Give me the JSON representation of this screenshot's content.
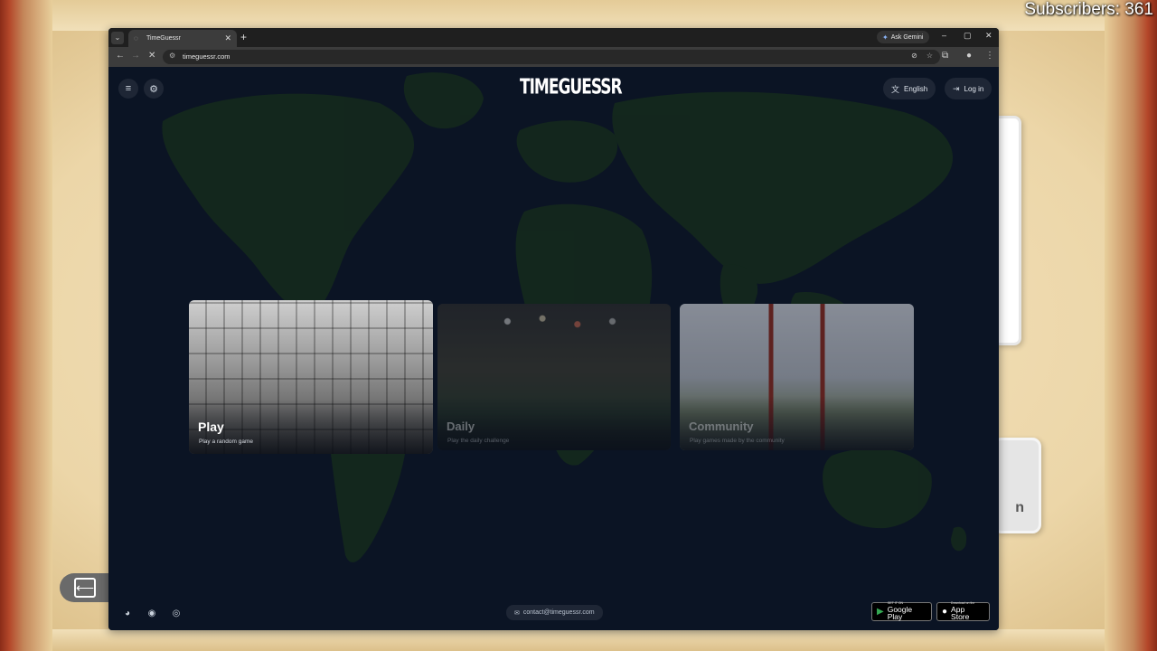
{
  "overlay": {
    "subscribers": "Subscribers: 361"
  },
  "browser": {
    "tab_title": "TimeGuessr",
    "new_tab": "+",
    "ask_gemini": "Ask Gemini",
    "url": "timeguessr.com",
    "window_controls": [
      "–",
      "▢",
      "✕"
    ]
  },
  "page": {
    "logo_text": "TIMEGUESSR",
    "language_label": "English",
    "login_label": "Log in",
    "modes": [
      {
        "title": "Play",
        "subtitle": "Play a random game"
      },
      {
        "title": "Daily",
        "subtitle": "Play the daily challenge"
      },
      {
        "title": "Community",
        "subtitle": "Play games made by the community"
      }
    ],
    "contact_email": "contact@timeguessr.com",
    "google_play": {
      "small": "GET IT ON",
      "big": "Google Play"
    },
    "app_store": {
      "small": "Download on the",
      "big": "App Store"
    }
  },
  "colors": {
    "page_bg": "#0b1424",
    "map_land": "#17331f",
    "text_primary": "#ffffff"
  },
  "icons": {
    "menu": "menu-icon",
    "settings": "gear-icon",
    "translate": "translate-icon",
    "login": "login-icon",
    "discord": "discord-icon",
    "reddit": "reddit-icon",
    "instagram": "instagram-icon",
    "mail": "mail-icon"
  }
}
